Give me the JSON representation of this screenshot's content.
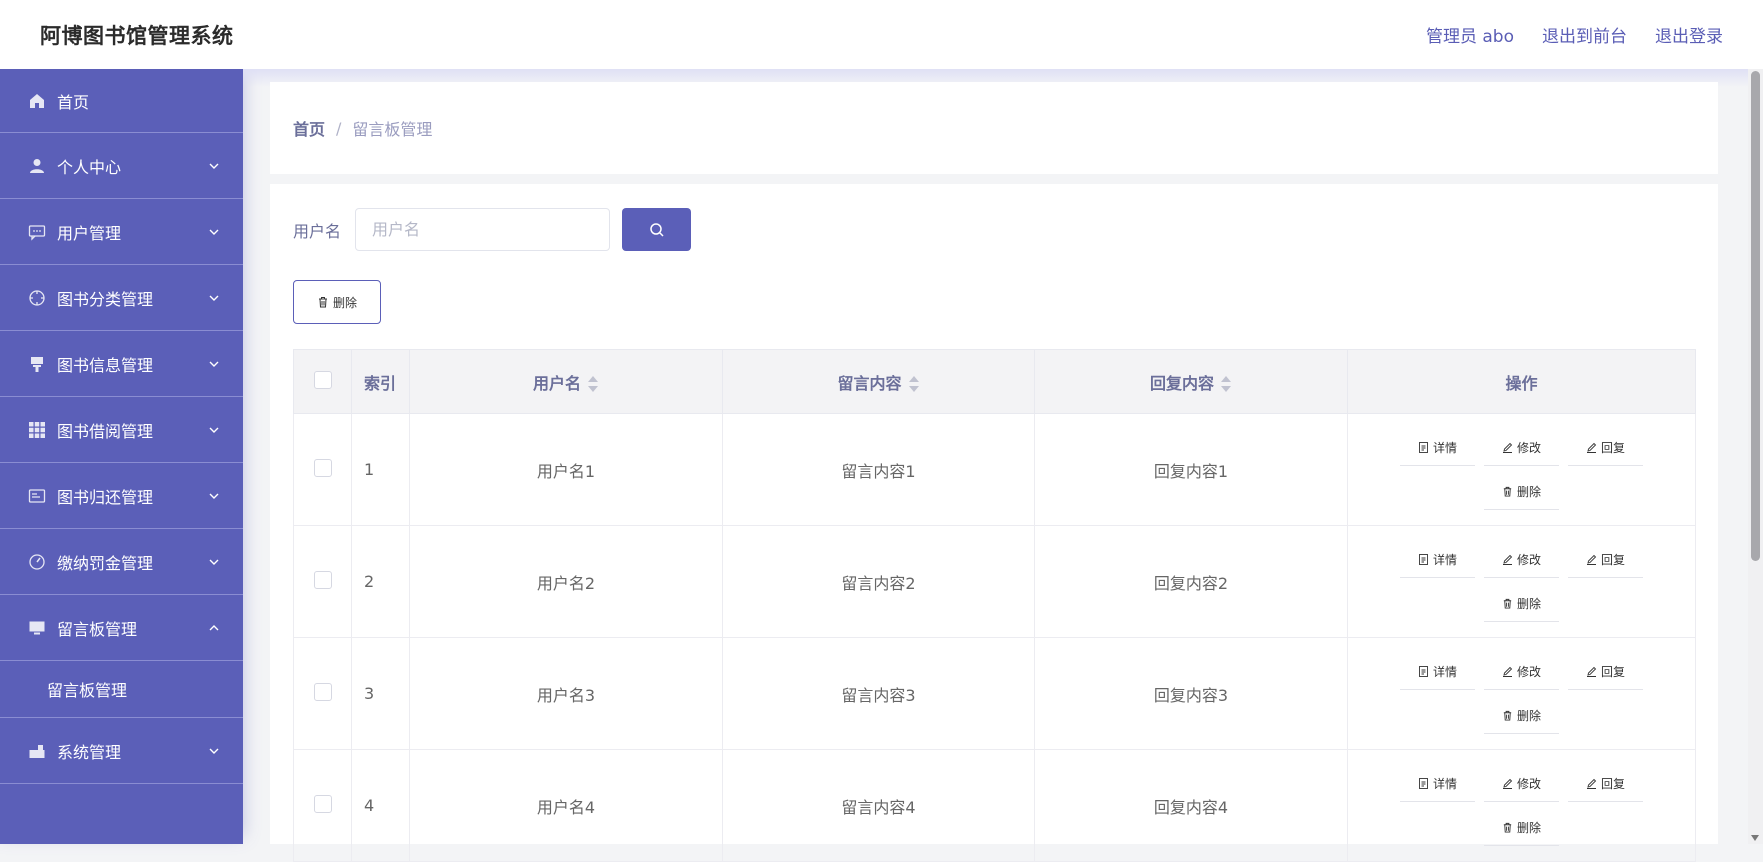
{
  "app": {
    "title": "阿博图书馆管理系统"
  },
  "header": {
    "admin_label": "管理员 abo",
    "front_label": "退出到前台",
    "logout_label": "退出登录"
  },
  "sidebar": {
    "items": [
      {
        "label": "首页",
        "icon": "home-icon"
      },
      {
        "label": "个人中心",
        "icon": "user-icon"
      },
      {
        "label": "用户管理",
        "icon": "message-icon"
      },
      {
        "label": "图书分类管理",
        "icon": "compass-icon"
      },
      {
        "label": "图书信息管理",
        "icon": "stamp-icon"
      },
      {
        "label": "图书借阅管理",
        "icon": "grid-icon"
      },
      {
        "label": "图书归还管理",
        "icon": "card-icon"
      },
      {
        "label": "缴纳罚金管理",
        "icon": "gauge-icon"
      },
      {
        "label": "留言板管理",
        "icon": "monitor-icon"
      },
      {
        "label": "系统管理",
        "icon": "toolbox-icon"
      }
    ],
    "submenu": {
      "label": "留言板管理"
    }
  },
  "breadcrumb": {
    "home": "首页",
    "separator": "/",
    "current": "留言板管理"
  },
  "search": {
    "label": "用户名",
    "placeholder": "用户名"
  },
  "toolbar": {
    "delete_label": "删除"
  },
  "table": {
    "headers": {
      "index": "索引",
      "username": "用户名",
      "content": "留言内容",
      "reply": "回复内容",
      "actions": "操作"
    },
    "actions": {
      "detail": "详情",
      "edit": "修改",
      "reply": "回复",
      "delete": "删除"
    },
    "rows": [
      {
        "index": "1",
        "username": "用户名1",
        "content": "留言内容1",
        "reply": "回复内容1"
      },
      {
        "index": "2",
        "username": "用户名2",
        "content": "留言内容2",
        "reply": "回复内容2"
      },
      {
        "index": "3",
        "username": "用户名3",
        "content": "留言内容3",
        "reply": "回复内容3"
      },
      {
        "index": "4",
        "username": "用户名4",
        "content": "留言内容4",
        "reply": "回复内容4"
      }
    ]
  },
  "colors": {
    "accent": "#5b5fb8",
    "sidebar_border": "#8a8dd2"
  }
}
